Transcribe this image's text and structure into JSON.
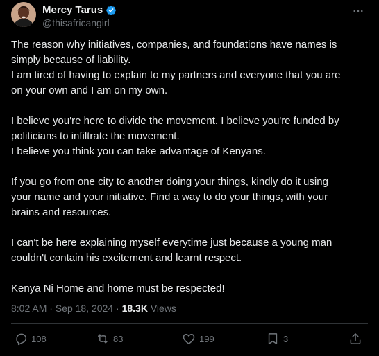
{
  "tweet": {
    "author": {
      "display_name": "Mercy Tarus",
      "handle": "@thisafricangirl",
      "verified": true
    },
    "paragraphs": [
      [
        "The reason why initiatives, companies,  and foundations have names is",
        "simply because of liability.",
        "I am tired of having to explain to my partners and everyone that you are",
        "on your own and I am on my own."
      ],
      [
        "I believe you're here to divide the movement. I believe you're funded by",
        "politicians to infiltrate the movement.",
        "I believe you think you can take advantage of Kenyans."
      ],
      [
        "If you go from one city to another doing your things, kindly do it using",
        "your name and your initiative. Find a way to do your things, with your",
        "brains and resources."
      ],
      [
        "I can't be here explaining myself everytime just because a young man",
        "couldn't contain his excitement and learnt respect."
      ],
      [
        "Kenya Ni Home and home must be respected!"
      ]
    ],
    "time": "8:02 AM",
    "separator": "·",
    "date": "Sep 18, 2024",
    "views_count": "18.3K",
    "views_label": "Views",
    "actions": {
      "replies": {
        "icon": "reply-icon",
        "count": "108"
      },
      "reposts": {
        "icon": "repost-icon",
        "count": "83"
      },
      "likes": {
        "icon": "heart-icon",
        "count": "199"
      },
      "bookmarks": {
        "icon": "bookmark-icon",
        "count": "3"
      },
      "share": {
        "icon": "share-icon"
      }
    }
  },
  "colors": {
    "background": "#000000",
    "text_primary": "#e7e9ea",
    "text_secondary": "#71767b",
    "verified_blue": "#1d9bf0",
    "divider": "#2f3336"
  }
}
